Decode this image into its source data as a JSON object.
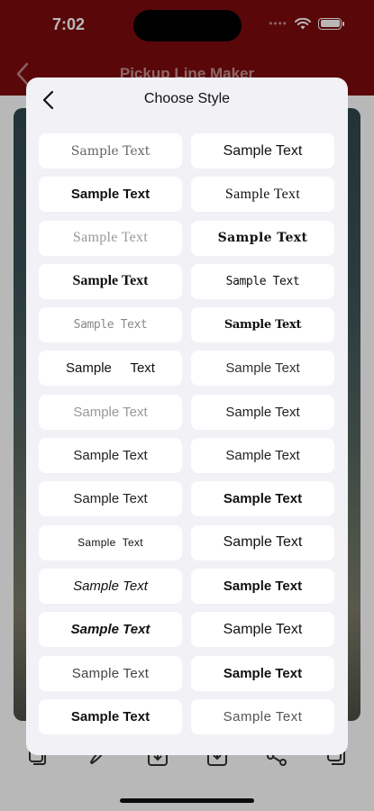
{
  "status_bar": {
    "time": "7:02"
  },
  "app": {
    "title": "Pickup Line Maker"
  },
  "modal": {
    "title": "Choose Style",
    "styles": [
      {
        "label": "Sample Text",
        "style": "s-serif-gray"
      },
      {
        "label": "Sample Text",
        "style": "s-regular-lg"
      },
      {
        "label": "Sample Text",
        "style": "s-bold"
      },
      {
        "label": "Sample Text",
        "style": "s-serif"
      },
      {
        "label": "Sample Text",
        "style": "s-serif-light"
      },
      {
        "label": "Sample Text",
        "style": "s-serif-bold-wide"
      },
      {
        "label": "Sample Text",
        "style": "s-serif-bold"
      },
      {
        "label": "Sample Text",
        "style": "s-mono"
      },
      {
        "label": "Sample Text",
        "style": "s-mono-gray"
      },
      {
        "label": "Sample Text",
        "style": "s-condensed-bold"
      },
      {
        "label": "Sample     Text",
        "style": "s-spaced"
      },
      {
        "label": "Sample Text",
        "style": "s-light"
      },
      {
        "label": "Sample Text",
        "style": "s-light-gray"
      },
      {
        "label": "Sample Text",
        "style": "s-medium"
      },
      {
        "label": "Sample Text",
        "style": "s-medium"
      },
      {
        "label": "Sample Text",
        "style": "s-medium"
      },
      {
        "label": "Sample Text",
        "style": "s-medium"
      },
      {
        "label": "Sample Text",
        "style": "s-bold"
      },
      {
        "label": "Sample  Text",
        "style": "s-small"
      },
      {
        "label": "Sample Text",
        "style": "s-regular-lg"
      },
      {
        "label": "Sample Text",
        "style": "s-italic"
      },
      {
        "label": "Sample Text",
        "style": "s-bold-lg"
      },
      {
        "label": "Sample Text",
        "style": "s-bold-italic"
      },
      {
        "label": "Sample Text",
        "style": "s-regular-lg"
      },
      {
        "label": "Sample Text",
        "style": "s-thin"
      },
      {
        "label": "Sample Text",
        "style": "s-bold-lg"
      },
      {
        "label": "Sample Text",
        "style": "s-bold-lg"
      },
      {
        "label": "Sample Text",
        "style": "s-thin2"
      }
    ]
  },
  "toolbar": {
    "icons": [
      "layers-icon",
      "brush-icon",
      "download-icon",
      "save-icon",
      "share-icon",
      "copy-icon"
    ]
  },
  "colors": {
    "header": "#7d0a0d",
    "modal_bg": "#f2f1f6",
    "cell_bg": "#ffffff"
  }
}
